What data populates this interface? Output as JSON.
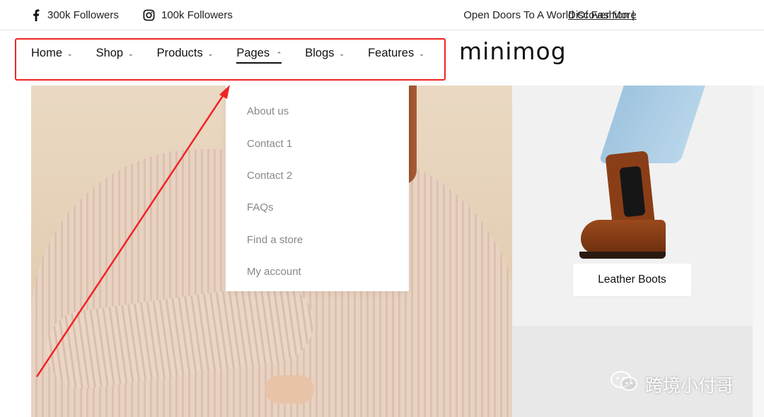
{
  "topbar": {
    "facebook": {
      "icon": "facebook-icon",
      "label": "300k Followers"
    },
    "instagram": {
      "icon": "instagram-icon",
      "label": "100k Followers"
    },
    "announcement": "Open Doors To A World Of Fashion |",
    "announcement_link": "Discover More"
  },
  "nav": {
    "items": [
      {
        "label": "Home",
        "icon": "chevron-down-icon"
      },
      {
        "label": "Shop",
        "icon": "chevron-down-icon"
      },
      {
        "label": "Products",
        "icon": "chevron-down-icon"
      },
      {
        "label": "Pages",
        "icon": "chevron-up-icon",
        "active": true
      },
      {
        "label": "Blogs",
        "icon": "chevron-down-icon"
      },
      {
        "label": "Features",
        "icon": "chevron-down-icon"
      }
    ]
  },
  "logo": "minimog",
  "dropdown": {
    "items": [
      "About us",
      "Contact 1",
      "Contact 2",
      "FAQs",
      "Find a store",
      "My account"
    ]
  },
  "product_tag": "Leather Boots",
  "watermark": {
    "icon": "wechat-icon",
    "text": "跨境小付哥"
  },
  "colors": {
    "annotation": "#f02424",
    "text": "#111111",
    "dropdown_text": "#888888"
  }
}
